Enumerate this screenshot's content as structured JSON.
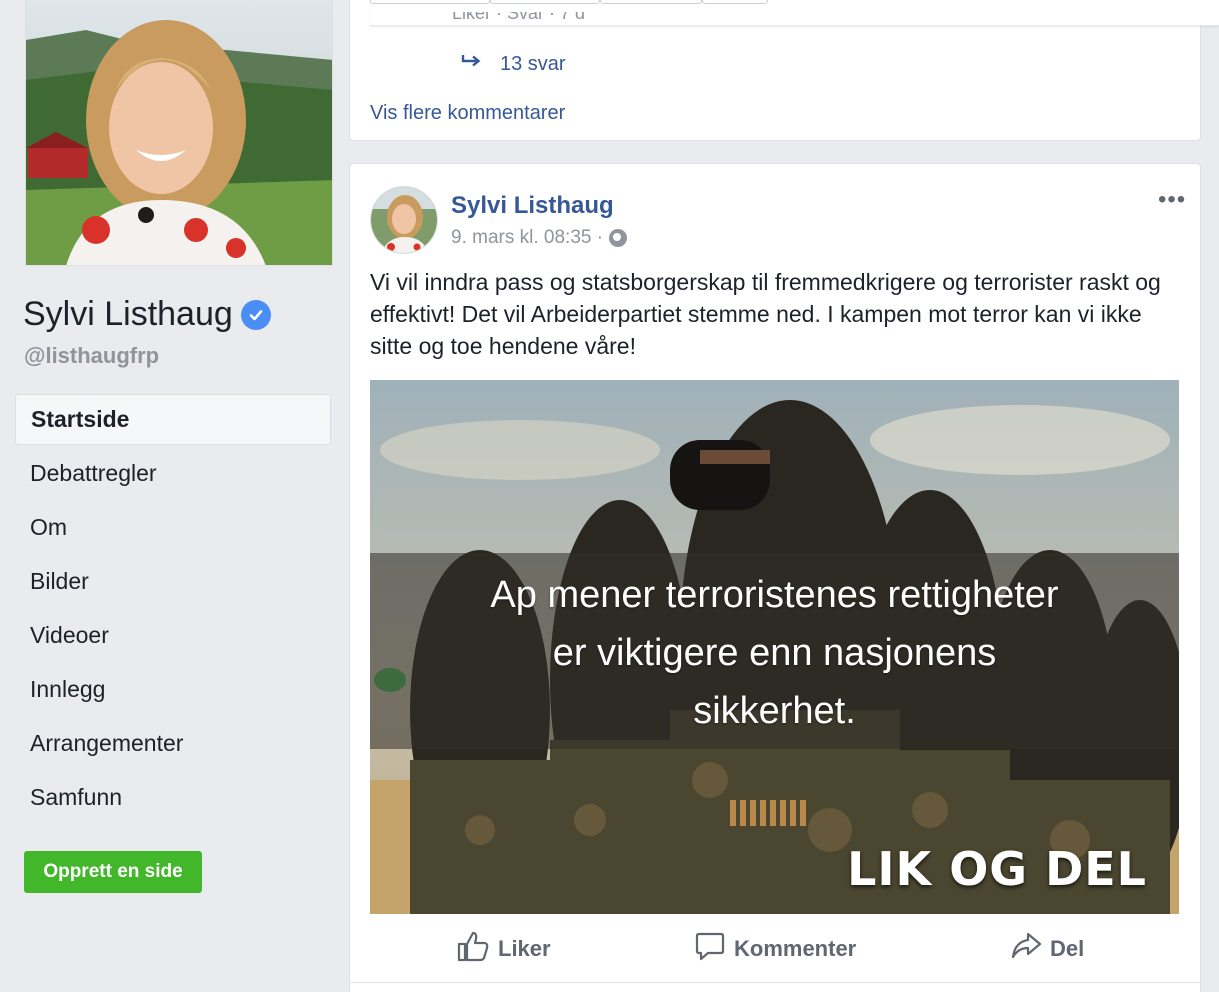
{
  "profile": {
    "name": "Sylvi Listhaug",
    "handle": "@listhaugfrp",
    "verified": true
  },
  "nav": {
    "items": [
      {
        "label": "Startside",
        "active": true
      },
      {
        "label": "Debattregler"
      },
      {
        "label": "Om"
      },
      {
        "label": "Bilder"
      },
      {
        "label": "Videoer"
      },
      {
        "label": "Innlegg"
      },
      {
        "label": "Arrangementer"
      },
      {
        "label": "Samfunn"
      }
    ],
    "create_page_label": "Opprett en side"
  },
  "previous_post": {
    "cut_text": "Liker · Svar · 7 d",
    "reply_count": "13 svar",
    "more_comments": "Vis flere kommentarer"
  },
  "post": {
    "author": "Sylvi Listhaug",
    "timestamp": "9. mars kl. 08:35 ·",
    "text": "Vi vil inndra pass og statsborgerskap til fremmedkrigere og terrorister raskt og effektivt! Det vil Arbeiderpartiet stemme ned. I kampen mot terror kan vi ikke sitte og toe hendene våre!",
    "image": {
      "overlay_lines": [
        "Ap mener terroristenes rettigheter",
        "er viktigere enn nasjonens",
        "sikkerhet."
      ],
      "footer_text": "LIK OG DEL"
    },
    "actions": {
      "like": "Liker",
      "comment": "Kommenter",
      "share": "Del"
    }
  },
  "colors": {
    "link": "#365899",
    "verified_badge": "#4a8ef5",
    "create_button": "#42b72a",
    "page_bg": "#e9ebee"
  }
}
